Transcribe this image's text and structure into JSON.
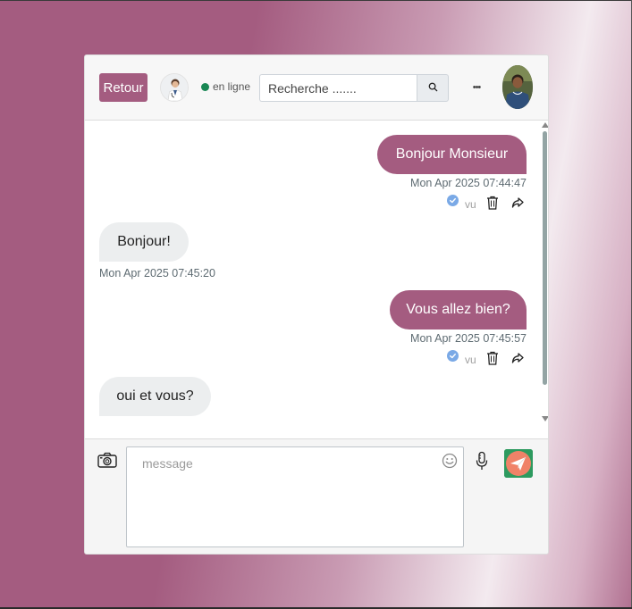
{
  "header": {
    "back_label": "Retour",
    "status_text": "en ligne",
    "search_placeholder": "Recherche .......",
    "more_label": "•••"
  },
  "messages": [
    {
      "direction": "out",
      "text": "Bonjour Monsieur",
      "time": "Mon Apr 2025 07:44:47",
      "seen_label": "vu"
    },
    {
      "direction": "in",
      "text": "Bonjour!",
      "time": "Mon Apr 2025 07:45:20"
    },
    {
      "direction": "out",
      "text": "Vous allez bien?",
      "time": "Mon Apr 2025 07:45:57",
      "seen_label": "vu"
    },
    {
      "direction": "in",
      "text": "oui et vous?"
    }
  ],
  "composer": {
    "placeholder": "message"
  },
  "colors": {
    "accent": "#a45c80",
    "online": "#198754",
    "incoming_bubble": "#eceeef",
    "seen_check": "#7aa9e6",
    "send_button": "#2d9a5f"
  },
  "icons": {
    "search": "search-icon",
    "more": "more-options-icon",
    "camera": "camera-icon",
    "emoji": "emoji-icon",
    "mic": "microphone-icon",
    "send": "send-icon",
    "delete": "trash-icon",
    "forward": "forward-icon",
    "seen": "check-circle-icon"
  }
}
